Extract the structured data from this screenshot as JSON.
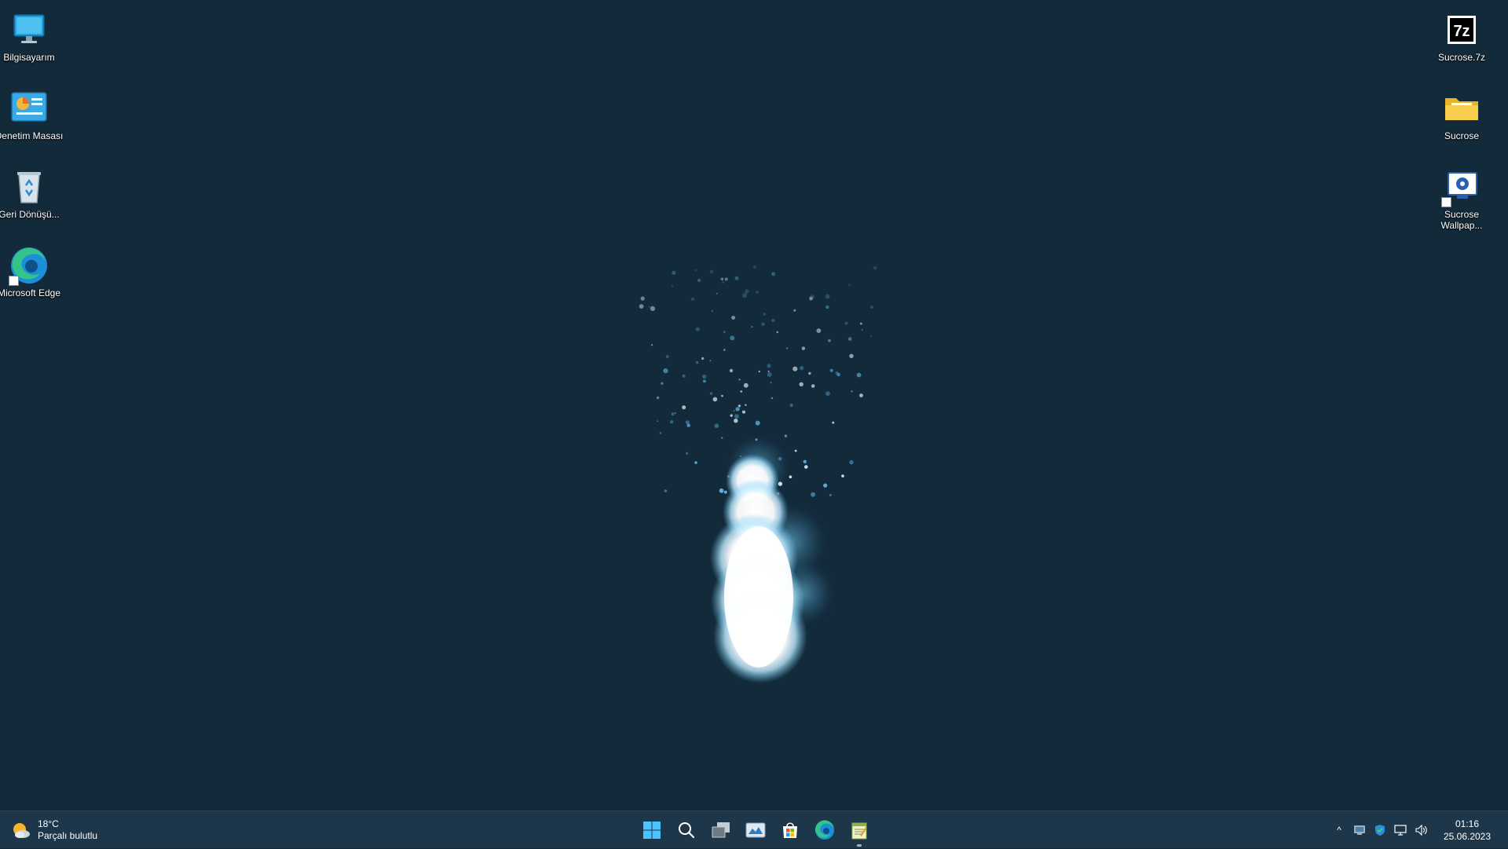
{
  "desktop": {
    "left_icons": [
      {
        "label": "Bilgisayarım",
        "icon": "computer-monitor-icon"
      },
      {
        "label": "Denetim Masası",
        "icon": "control-panel-icon"
      },
      {
        "label": "Geri Dönüşü...",
        "icon": "recycle-bin-icon"
      },
      {
        "label": "Microsoft Edge",
        "icon": "edge-icon"
      }
    ],
    "right_icons": [
      {
        "label": "Sucrose.7z",
        "icon": "7z-archive-icon"
      },
      {
        "label": "Sucrose",
        "icon": "folder-icon"
      },
      {
        "label": "Sucrose Wallpap...",
        "icon": "sucrose-wallpaper-icon"
      }
    ]
  },
  "taskbar": {
    "weather": {
      "temp": "18°C",
      "condition": "Parçalı bulutlu",
      "icon": "partly-cloudy-icon"
    },
    "pinned": [
      {
        "name": "start",
        "icon": "windows-start-icon"
      },
      {
        "name": "search",
        "icon": "search-icon"
      },
      {
        "name": "task-view",
        "icon": "task-view-icon"
      },
      {
        "name": "photos",
        "icon": "photos-app-icon"
      },
      {
        "name": "store",
        "icon": "microsoft-store-icon"
      },
      {
        "name": "edge",
        "icon": "edge-icon"
      },
      {
        "name": "notepad",
        "icon": "notepad-app-icon",
        "active": true
      }
    ],
    "tray": {
      "chevron": "^",
      "clock_time": "01:16",
      "clock_date": "25.06.2023"
    }
  },
  "colors": {
    "desktop_bg": "#132a3a",
    "taskbar_bg": "#1d3649",
    "flame_glow": "#5fc4ee"
  }
}
